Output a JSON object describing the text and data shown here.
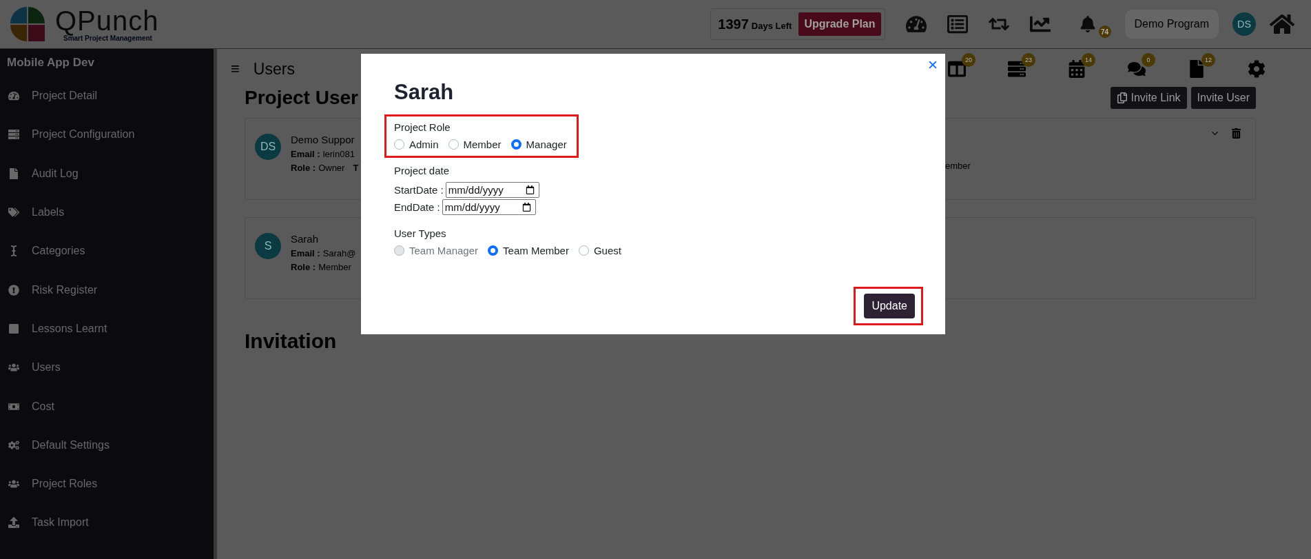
{
  "header": {
    "logo": {
      "name": "QPunch",
      "tagline": "Smart Project Management"
    },
    "days": {
      "count": "1397",
      "label": "Days Left"
    },
    "upgrade_button": "Upgrade Plan",
    "notification_badge": "74",
    "program": "Demo Program",
    "avatar": "DS"
  },
  "sidebar": {
    "title": "Mobile App Dev",
    "items": [
      {
        "label": "Project Detail"
      },
      {
        "label": "Project Configuration"
      },
      {
        "label": "Audit Log"
      },
      {
        "label": "Labels"
      },
      {
        "label": "Categories"
      },
      {
        "label": "Risk Register"
      },
      {
        "label": "Lessons Learnt"
      },
      {
        "label": "Users"
      },
      {
        "label": "Cost"
      },
      {
        "label": "Default Settings"
      },
      {
        "label": "Project Roles"
      },
      {
        "label": "Task Import"
      }
    ]
  },
  "main": {
    "menu_glyph": "≡",
    "title": "Users",
    "tab_badges": [
      "20",
      "23",
      "14",
      "0",
      "12"
    ],
    "heading": "Project User",
    "invite_link": "Invite Link",
    "invite_user": "Invite User",
    "users": [
      {
        "avatar": "DS",
        "name": "Demo Suppor",
        "email_label": "Email :",
        "email": "lerin081",
        "role_label": "Role :",
        "role": "Owner",
        "cut_label": "T",
        "peek_text": "ember"
      },
      {
        "avatar": "S",
        "name": "Sarah",
        "email_label": "Email :",
        "email": "Sarah@",
        "role_label": "Role :",
        "role": "Member"
      }
    ],
    "invitation_heading": "Invitation"
  },
  "modal": {
    "title": "Sarah",
    "role": {
      "label": "Project Role",
      "highlighted": true,
      "options": [
        {
          "label": "Admin",
          "selected": false,
          "disabled": false
        },
        {
          "label": "Member",
          "selected": false,
          "disabled": false
        },
        {
          "label": "Manager",
          "selected": true,
          "disabled": false
        }
      ]
    },
    "date": {
      "label": "Project date",
      "fields": [
        {
          "label": "StartDate :",
          "placeholder": "mm/dd/yyyy"
        },
        {
          "label": "EndDate :",
          "placeholder": "mm/dd/yyyy"
        }
      ]
    },
    "user_types": {
      "label": "User Types",
      "options": [
        {
          "label": "Team Manager",
          "selected": false,
          "disabled": true
        },
        {
          "label": "Team Member",
          "selected": true,
          "disabled": false
        },
        {
          "label": "Guest",
          "selected": false,
          "disabled": false
        }
      ]
    },
    "update_button": {
      "label": "Update",
      "highlighted": true
    }
  }
}
